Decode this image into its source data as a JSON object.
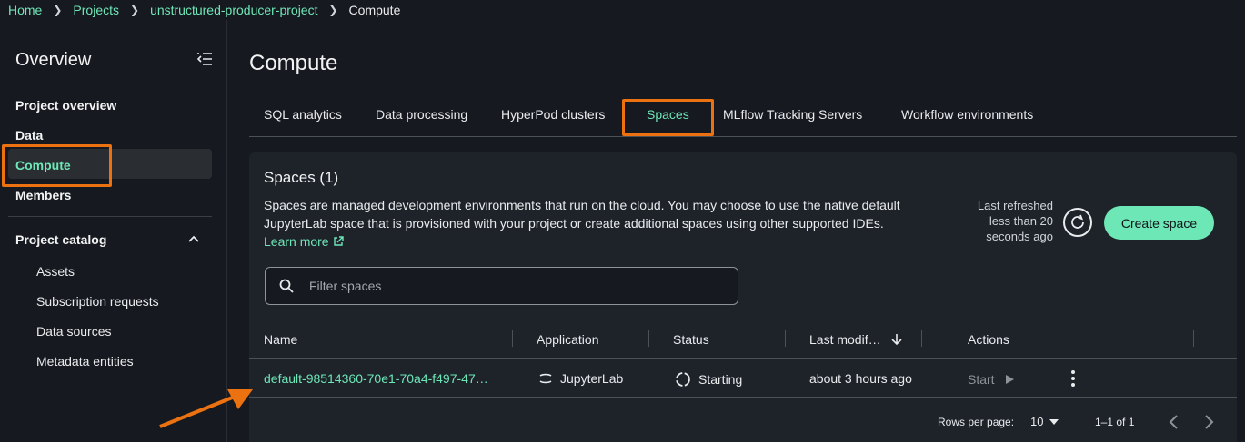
{
  "breadcrumb": {
    "items": [
      "Home",
      "Projects",
      "unstructured-producer-project"
    ],
    "current": "Compute"
  },
  "sidebar": {
    "title": "Overview",
    "items": [
      {
        "label": "Project overview"
      },
      {
        "label": "Data"
      },
      {
        "label": "Compute",
        "active": true
      },
      {
        "label": "Members"
      }
    ],
    "catalog": {
      "title": "Project catalog",
      "items": [
        "Assets",
        "Subscription requests",
        "Data sources",
        "Metadata entities"
      ]
    }
  },
  "page": {
    "title": "Compute",
    "tabs": [
      "SQL analytics",
      "Data processing",
      "HyperPod clusters",
      "Spaces",
      "MLflow Tracking Servers",
      "Workflow environments"
    ],
    "active_tab": "Spaces"
  },
  "panel": {
    "title": "Spaces (1)",
    "description": "Spaces are managed development environments that run on the cloud. You may choose to use the native default JupyterLab space that is provisioned with your project or create additional spaces using other supported IDEs.",
    "learn_more": "Learn more",
    "refreshed": "Last refreshed less than 20 seconds ago",
    "create_button": "Create space",
    "filter_placeholder": "Filter spaces"
  },
  "table": {
    "columns": [
      "Name",
      "Application",
      "Status",
      "Last modif…",
      "Actions"
    ],
    "rows": [
      {
        "name": "default-98514360-70e1-70a4-f497-47…",
        "application": "JupyterLab",
        "status": "Starting",
        "last_modified": "about 3 hours ago",
        "action": "Start"
      }
    ]
  },
  "pagination": {
    "rows_per_page_label": "Rows per page:",
    "rows_per_page": "10",
    "range": "1–1 of 1"
  },
  "colors": {
    "accent": "#6ee7b7",
    "annotation": "#ec7211",
    "background": "#16191f",
    "panel": "#1e232a"
  }
}
